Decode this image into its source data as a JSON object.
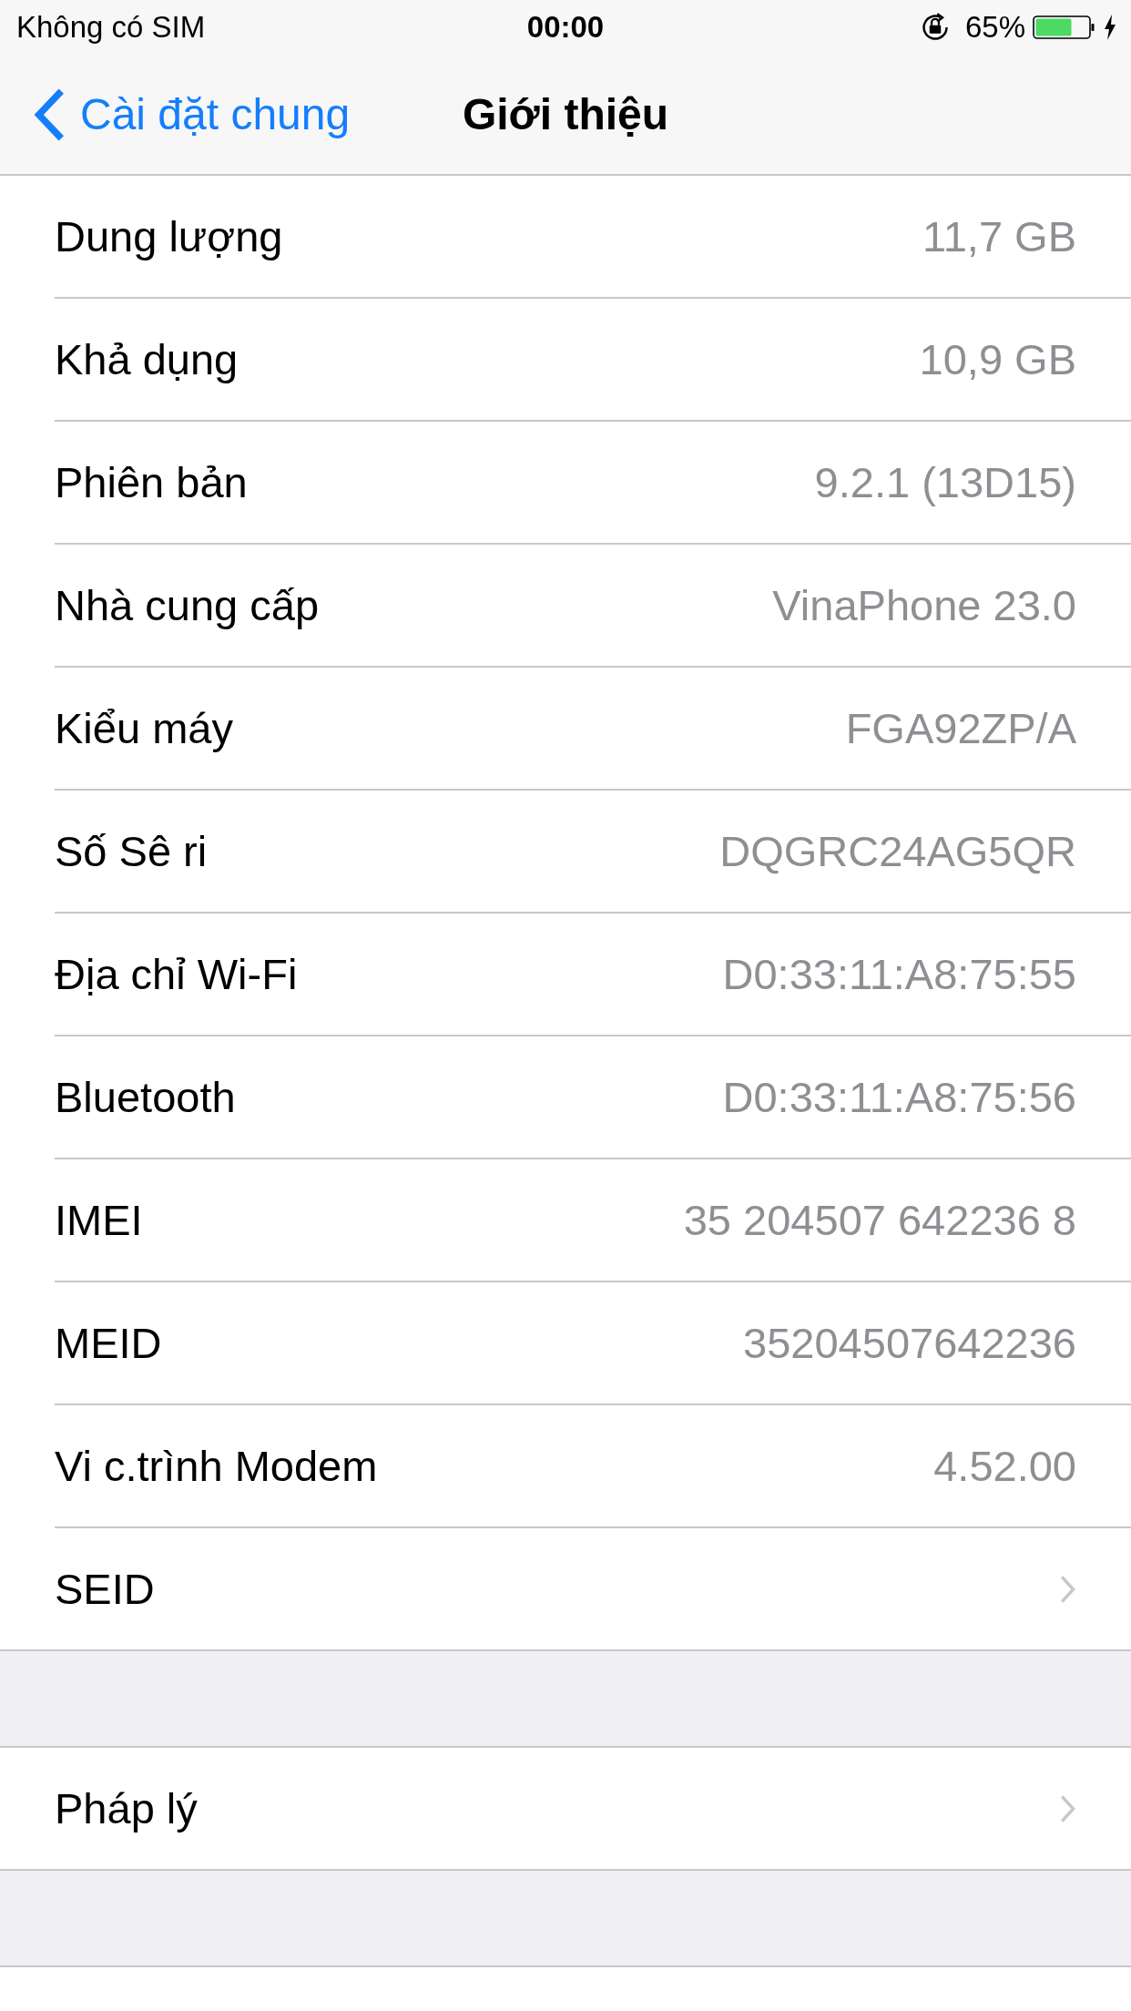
{
  "status_bar": {
    "carrier": "Không có SIM",
    "time": "00:00",
    "battery": "65%"
  },
  "nav": {
    "back": "Cài đặt chung",
    "title": "Giới thiệu"
  },
  "sections": [
    {
      "rows": [
        {
          "kind": "value",
          "label": "Dung lượng",
          "value": "11,7 GB"
        },
        {
          "kind": "value",
          "label": "Khả dụng",
          "value": "10,9 GB"
        },
        {
          "kind": "value",
          "label": "Phiên bản",
          "value": "9.2.1 (13D15)"
        },
        {
          "kind": "value",
          "label": "Nhà cung cấp",
          "value": "VinaPhone 23.0"
        },
        {
          "kind": "value",
          "label": "Kiểu máy",
          "value": "FGA92ZP/A"
        },
        {
          "kind": "value",
          "label": "Số Sê ri",
          "value": "DQGRC24AG5QR"
        },
        {
          "kind": "value",
          "label": "Địa chỉ Wi-Fi",
          "value": "D0:33:11:A8:75:55"
        },
        {
          "kind": "value",
          "label": "Bluetooth",
          "value": "D0:33:11:A8:75:56"
        },
        {
          "kind": "value",
          "label": "IMEI",
          "value": "35 204507 642236 8"
        },
        {
          "kind": "value",
          "label": "MEID",
          "value": "35204507642236"
        },
        {
          "kind": "value",
          "label": "Vi c.trình Modem",
          "value": "4.52.00"
        },
        {
          "kind": "link",
          "label": "SEID"
        }
      ]
    },
    {
      "rows": [
        {
          "kind": "link",
          "label": "Pháp lý"
        }
      ]
    }
  ]
}
